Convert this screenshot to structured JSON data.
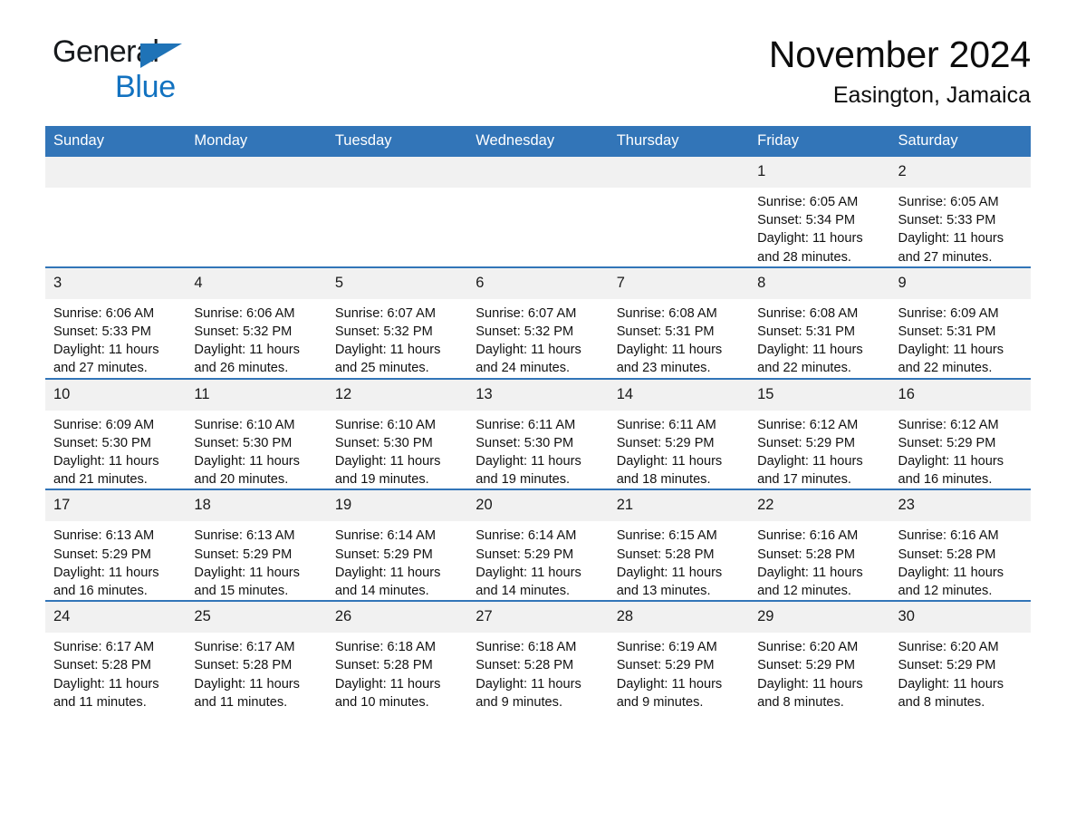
{
  "brand": {
    "name_part1": "General",
    "name_part2": "Blue",
    "accent_color": "#1272c0",
    "header_color": "#3275b8"
  },
  "header": {
    "title": "November 2024",
    "subtitle": "Easington, Jamaica"
  },
  "weekday_headers": [
    "Sunday",
    "Monday",
    "Tuesday",
    "Wednesday",
    "Thursday",
    "Friday",
    "Saturday"
  ],
  "labels": {
    "sunrise_prefix": "Sunrise:",
    "sunset_prefix": "Sunset:",
    "daylight_prefix": "Daylight:"
  },
  "weeks": [
    [
      {
        "day": "",
        "sunrise": "",
        "sunset": "",
        "daylight_line1": "",
        "daylight_line2": "",
        "empty": true
      },
      {
        "day": "",
        "sunrise": "",
        "sunset": "",
        "daylight_line1": "",
        "daylight_line2": "",
        "empty": true
      },
      {
        "day": "",
        "sunrise": "",
        "sunset": "",
        "daylight_line1": "",
        "daylight_line2": "",
        "empty": true
      },
      {
        "day": "",
        "sunrise": "",
        "sunset": "",
        "daylight_line1": "",
        "daylight_line2": "",
        "empty": true
      },
      {
        "day": "",
        "sunrise": "",
        "sunset": "",
        "daylight_line1": "",
        "daylight_line2": "",
        "empty": true
      },
      {
        "day": "1",
        "sunrise": "Sunrise: 6:05 AM",
        "sunset": "Sunset: 5:34 PM",
        "daylight_line1": "Daylight: 11 hours",
        "daylight_line2": "and 28 minutes."
      },
      {
        "day": "2",
        "sunrise": "Sunrise: 6:05 AM",
        "sunset": "Sunset: 5:33 PM",
        "daylight_line1": "Daylight: 11 hours",
        "daylight_line2": "and 27 minutes."
      }
    ],
    [
      {
        "day": "3",
        "sunrise": "Sunrise: 6:06 AM",
        "sunset": "Sunset: 5:33 PM",
        "daylight_line1": "Daylight: 11 hours",
        "daylight_line2": "and 27 minutes."
      },
      {
        "day": "4",
        "sunrise": "Sunrise: 6:06 AM",
        "sunset": "Sunset: 5:32 PM",
        "daylight_line1": "Daylight: 11 hours",
        "daylight_line2": "and 26 minutes."
      },
      {
        "day": "5",
        "sunrise": "Sunrise: 6:07 AM",
        "sunset": "Sunset: 5:32 PM",
        "daylight_line1": "Daylight: 11 hours",
        "daylight_line2": "and 25 minutes."
      },
      {
        "day": "6",
        "sunrise": "Sunrise: 6:07 AM",
        "sunset": "Sunset: 5:32 PM",
        "daylight_line1": "Daylight: 11 hours",
        "daylight_line2": "and 24 minutes."
      },
      {
        "day": "7",
        "sunrise": "Sunrise: 6:08 AM",
        "sunset": "Sunset: 5:31 PM",
        "daylight_line1": "Daylight: 11 hours",
        "daylight_line2": "and 23 minutes."
      },
      {
        "day": "8",
        "sunrise": "Sunrise: 6:08 AM",
        "sunset": "Sunset: 5:31 PM",
        "daylight_line1": "Daylight: 11 hours",
        "daylight_line2": "and 22 minutes."
      },
      {
        "day": "9",
        "sunrise": "Sunrise: 6:09 AM",
        "sunset": "Sunset: 5:31 PM",
        "daylight_line1": "Daylight: 11 hours",
        "daylight_line2": "and 22 minutes."
      }
    ],
    [
      {
        "day": "10",
        "sunrise": "Sunrise: 6:09 AM",
        "sunset": "Sunset: 5:30 PM",
        "daylight_line1": "Daylight: 11 hours",
        "daylight_line2": "and 21 minutes."
      },
      {
        "day": "11",
        "sunrise": "Sunrise: 6:10 AM",
        "sunset": "Sunset: 5:30 PM",
        "daylight_line1": "Daylight: 11 hours",
        "daylight_line2": "and 20 minutes."
      },
      {
        "day": "12",
        "sunrise": "Sunrise: 6:10 AM",
        "sunset": "Sunset: 5:30 PM",
        "daylight_line1": "Daylight: 11 hours",
        "daylight_line2": "and 19 minutes."
      },
      {
        "day": "13",
        "sunrise": "Sunrise: 6:11 AM",
        "sunset": "Sunset: 5:30 PM",
        "daylight_line1": "Daylight: 11 hours",
        "daylight_line2": "and 19 minutes."
      },
      {
        "day": "14",
        "sunrise": "Sunrise: 6:11 AM",
        "sunset": "Sunset: 5:29 PM",
        "daylight_line1": "Daylight: 11 hours",
        "daylight_line2": "and 18 minutes."
      },
      {
        "day": "15",
        "sunrise": "Sunrise: 6:12 AM",
        "sunset": "Sunset: 5:29 PM",
        "daylight_line1": "Daylight: 11 hours",
        "daylight_line2": "and 17 minutes."
      },
      {
        "day": "16",
        "sunrise": "Sunrise: 6:12 AM",
        "sunset": "Sunset: 5:29 PM",
        "daylight_line1": "Daylight: 11 hours",
        "daylight_line2": "and 16 minutes."
      }
    ],
    [
      {
        "day": "17",
        "sunrise": "Sunrise: 6:13 AM",
        "sunset": "Sunset: 5:29 PM",
        "daylight_line1": "Daylight: 11 hours",
        "daylight_line2": "and 16 minutes."
      },
      {
        "day": "18",
        "sunrise": "Sunrise: 6:13 AM",
        "sunset": "Sunset: 5:29 PM",
        "daylight_line1": "Daylight: 11 hours",
        "daylight_line2": "and 15 minutes."
      },
      {
        "day": "19",
        "sunrise": "Sunrise: 6:14 AM",
        "sunset": "Sunset: 5:29 PM",
        "daylight_line1": "Daylight: 11 hours",
        "daylight_line2": "and 14 minutes."
      },
      {
        "day": "20",
        "sunrise": "Sunrise: 6:14 AM",
        "sunset": "Sunset: 5:29 PM",
        "daylight_line1": "Daylight: 11 hours",
        "daylight_line2": "and 14 minutes."
      },
      {
        "day": "21",
        "sunrise": "Sunrise: 6:15 AM",
        "sunset": "Sunset: 5:28 PM",
        "daylight_line1": "Daylight: 11 hours",
        "daylight_line2": "and 13 minutes."
      },
      {
        "day": "22",
        "sunrise": "Sunrise: 6:16 AM",
        "sunset": "Sunset: 5:28 PM",
        "daylight_line1": "Daylight: 11 hours",
        "daylight_line2": "and 12 minutes."
      },
      {
        "day": "23",
        "sunrise": "Sunrise: 6:16 AM",
        "sunset": "Sunset: 5:28 PM",
        "daylight_line1": "Daylight: 11 hours",
        "daylight_line2": "and 12 minutes."
      }
    ],
    [
      {
        "day": "24",
        "sunrise": "Sunrise: 6:17 AM",
        "sunset": "Sunset: 5:28 PM",
        "daylight_line1": "Daylight: 11 hours",
        "daylight_line2": "and 11 minutes."
      },
      {
        "day": "25",
        "sunrise": "Sunrise: 6:17 AM",
        "sunset": "Sunset: 5:28 PM",
        "daylight_line1": "Daylight: 11 hours",
        "daylight_line2": "and 11 minutes."
      },
      {
        "day": "26",
        "sunrise": "Sunrise: 6:18 AM",
        "sunset": "Sunset: 5:28 PM",
        "daylight_line1": "Daylight: 11 hours",
        "daylight_line2": "and 10 minutes."
      },
      {
        "day": "27",
        "sunrise": "Sunrise: 6:18 AM",
        "sunset": "Sunset: 5:28 PM",
        "daylight_line1": "Daylight: 11 hours",
        "daylight_line2": "and 9 minutes."
      },
      {
        "day": "28",
        "sunrise": "Sunrise: 6:19 AM",
        "sunset": "Sunset: 5:29 PM",
        "daylight_line1": "Daylight: 11 hours",
        "daylight_line2": "and 9 minutes."
      },
      {
        "day": "29",
        "sunrise": "Sunrise: 6:20 AM",
        "sunset": "Sunset: 5:29 PM",
        "daylight_line1": "Daylight: 11 hours",
        "daylight_line2": "and 8 minutes."
      },
      {
        "day": "30",
        "sunrise": "Sunrise: 6:20 AM",
        "sunset": "Sunset: 5:29 PM",
        "daylight_line1": "Daylight: 11 hours",
        "daylight_line2": "and 8 minutes."
      }
    ]
  ]
}
